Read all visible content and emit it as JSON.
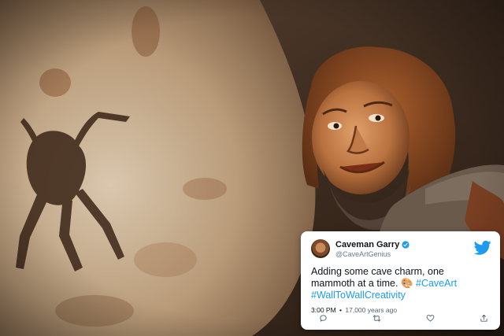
{
  "tweet": {
    "display_name": "Caveman Garry",
    "handle": "@CaveArtGenius",
    "text_plain": "Adding some cave charm, one mammoth at a time.",
    "emoji": "🎨",
    "hashtag_1": "#CaveArt",
    "hashtag_2": "#WallToWallCreativity",
    "time": "3:00 PM",
    "separator": "•",
    "age": "17,000 years ago"
  },
  "icons": {
    "brand": "bird-icon",
    "verified": "verified-badge-icon",
    "reply": "reply-icon",
    "retweet": "retweet-icon",
    "like": "heart-icon",
    "share": "share-icon"
  },
  "colors": {
    "accent": "#1d9bf0",
    "text": "#0f1419",
    "muted": "#6e7a85"
  }
}
